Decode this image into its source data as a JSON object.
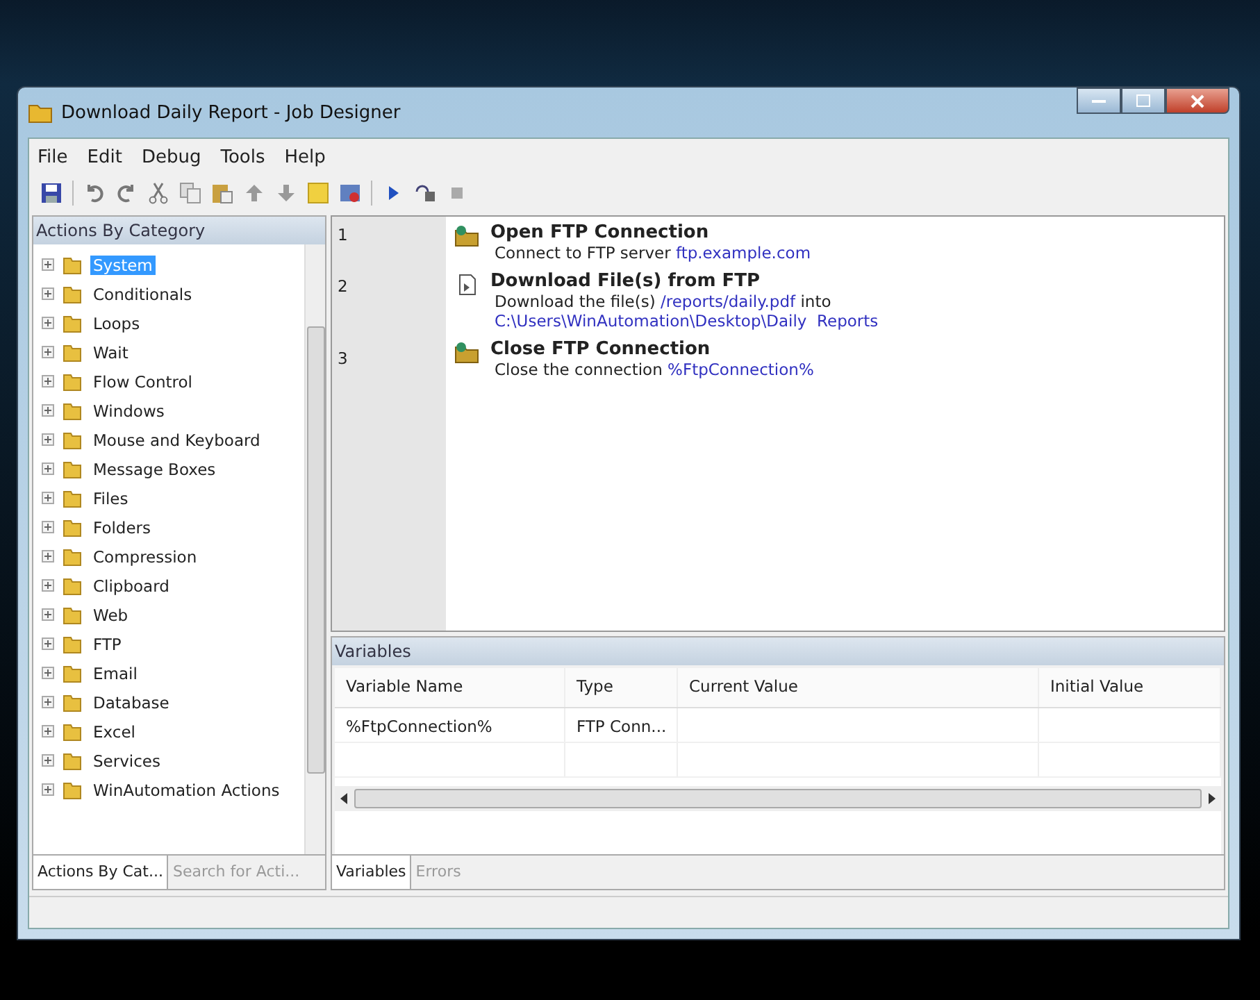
{
  "window": {
    "title": "Download Daily Report - Job Designer"
  },
  "menu": [
    "File",
    "Edit",
    "Debug",
    "Tools",
    "Help"
  ],
  "toolbar": [
    {
      "kind": "save"
    },
    {
      "kind": "sep"
    },
    {
      "kind": "undo"
    },
    {
      "kind": "redo"
    },
    {
      "kind": "cut"
    },
    {
      "kind": "copy"
    },
    {
      "kind": "paste"
    },
    {
      "kind": "up"
    },
    {
      "kind": "down"
    },
    {
      "kind": "note"
    },
    {
      "kind": "window"
    },
    {
      "kind": "sep"
    },
    {
      "kind": "run"
    },
    {
      "kind": "step"
    },
    {
      "kind": "stop"
    }
  ],
  "sidebar": {
    "title": "Actions By Category",
    "items": [
      {
        "label": "System",
        "selected": true
      },
      {
        "label": "Conditionals",
        "selected": false
      },
      {
        "label": "Loops",
        "selected": false
      },
      {
        "label": "Wait",
        "selected": false
      },
      {
        "label": "Flow Control",
        "selected": false
      },
      {
        "label": "Windows",
        "selected": false
      },
      {
        "label": "Mouse and Keyboard",
        "selected": false
      },
      {
        "label": "Message Boxes",
        "selected": false
      },
      {
        "label": "Files",
        "selected": false
      },
      {
        "label": "Folders",
        "selected": false
      },
      {
        "label": "Compression",
        "selected": false
      },
      {
        "label": "Clipboard",
        "selected": false
      },
      {
        "label": "Web",
        "selected": false
      },
      {
        "label": "FTP",
        "selected": false
      },
      {
        "label": "Email",
        "selected": false
      },
      {
        "label": "Database",
        "selected": false
      },
      {
        "label": "Excel",
        "selected": false
      },
      {
        "label": "Services",
        "selected": false
      },
      {
        "label": "WinAutomation Actions",
        "selected": false
      }
    ],
    "tabs": [
      {
        "label": "Actions By Cat...",
        "selected": true
      },
      {
        "label": "Search for Acti...",
        "selected": false
      }
    ]
  },
  "steps": [
    {
      "number": "1",
      "kind": "connect",
      "title": "Open FTP Connection",
      "lines": [
        [
          {
            "text": "Connect to FTP server ",
            "kind": "plain"
          },
          {
            "text": "ftp.example.com",
            "kind": "param"
          }
        ]
      ]
    },
    {
      "number": "2",
      "kind": "download",
      "title": "Download File(s) from FTP",
      "lines": [
        [
          {
            "text": "Download the file(s) ",
            "kind": "plain"
          },
          {
            "text": "/reports/daily.pdf",
            "kind": "param"
          },
          {
            "text": " into",
            "kind": "plain"
          }
        ],
        [
          {
            "text": "C:\\Users\\WinAutomation\\Desktop\\Daily  Reports",
            "kind": "param"
          }
        ]
      ]
    },
    {
      "number": "3",
      "kind": "connect",
      "title": "Close FTP Connection",
      "lines": [
        [
          {
            "text": "Close the connection ",
            "kind": "plain"
          },
          {
            "text": "%FtpConnection%",
            "kind": "param"
          }
        ]
      ]
    }
  ],
  "variables": {
    "title": "Variables",
    "columns": [
      "Variable Name",
      "Type",
      "Current Value",
      "Initial Value"
    ],
    "rows": [
      [
        "%FtpConnection%",
        "FTP Conn...",
        "",
        ""
      ]
    ],
    "tabs": [
      {
        "label": "Variables",
        "selected": true
      },
      {
        "label": "Errors",
        "selected": false
      }
    ]
  }
}
